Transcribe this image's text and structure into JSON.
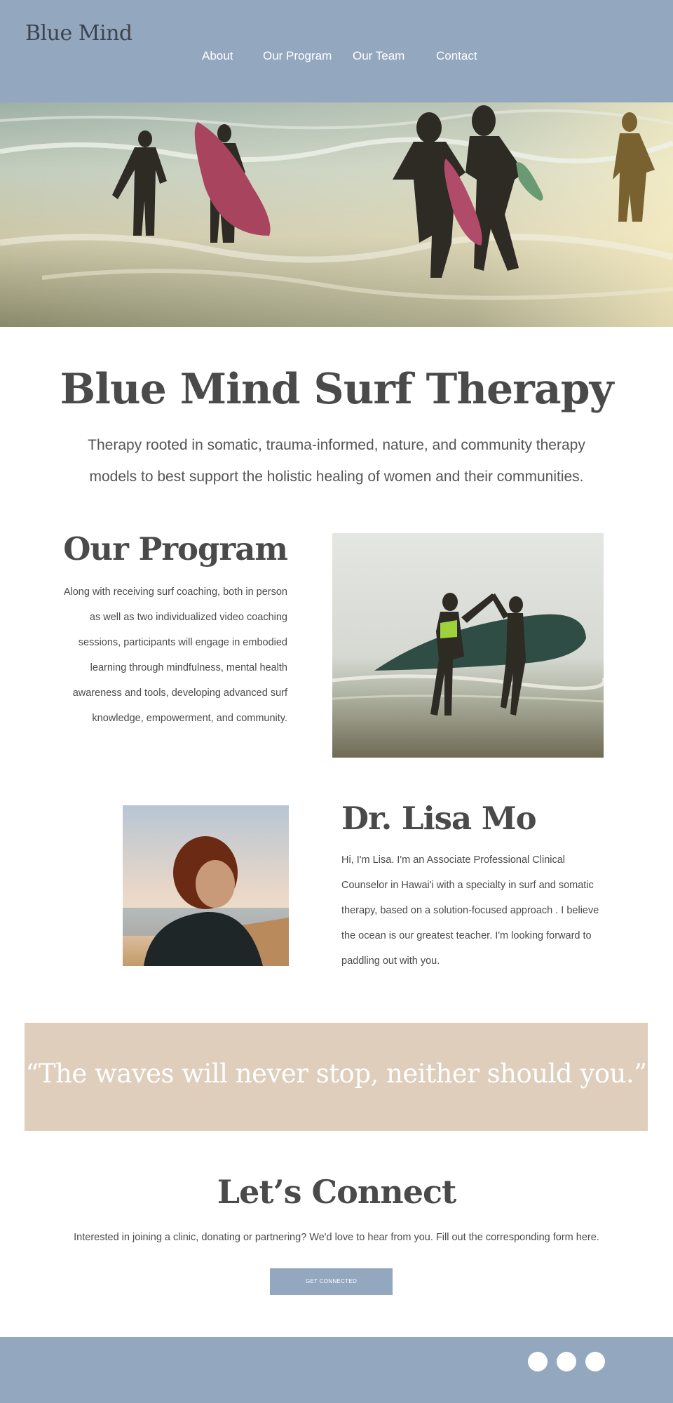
{
  "header": {
    "logo": "Blue Mind",
    "nav": [
      {
        "label": "About"
      },
      {
        "label": "Our Program"
      },
      {
        "label": "Our Team"
      },
      {
        "label": "Contact"
      }
    ]
  },
  "intro": {
    "title": "Blue Mind Surf Therapy",
    "subtitle": "Therapy rooted in somatic, trauma-informed, nature, and community therapy models to best support the holistic healing of women and their communities."
  },
  "program": {
    "heading": "Our Program",
    "text": "Along with receiving surf coaching, both in person as well as two individualized video coaching sessions, participants will engage in embodied learning through mindfulness, mental health awareness and tools, developing advanced surf knowledge, empowerment, and community."
  },
  "bio": {
    "heading": "Dr. Lisa Mo",
    "text": "Hi, I'm Lisa. I'm an Associate Professional Clinical Counselor in Hawai'i with a specialty in surf and somatic therapy, based on a solution-focused approach . I believe the ocean is our greatest teacher. I'm looking forward to paddling out with you."
  },
  "quote": {
    "text": "“The waves will never stop, neither should you.”"
  },
  "connect": {
    "heading": "Let’s Connect",
    "text": "Interested in joining a clinic, donating or partnering? We'd love to hear from you. Fill out the corresponding form here.",
    "button_label": "GET CONNECTED"
  },
  "footer": {
    "social_icons": [
      "social-icon",
      "social-icon",
      "social-icon"
    ]
  },
  "colors": {
    "header_bg": "#93a8bf",
    "quote_bg": "#decebb",
    "text": "#4a4a4a"
  }
}
